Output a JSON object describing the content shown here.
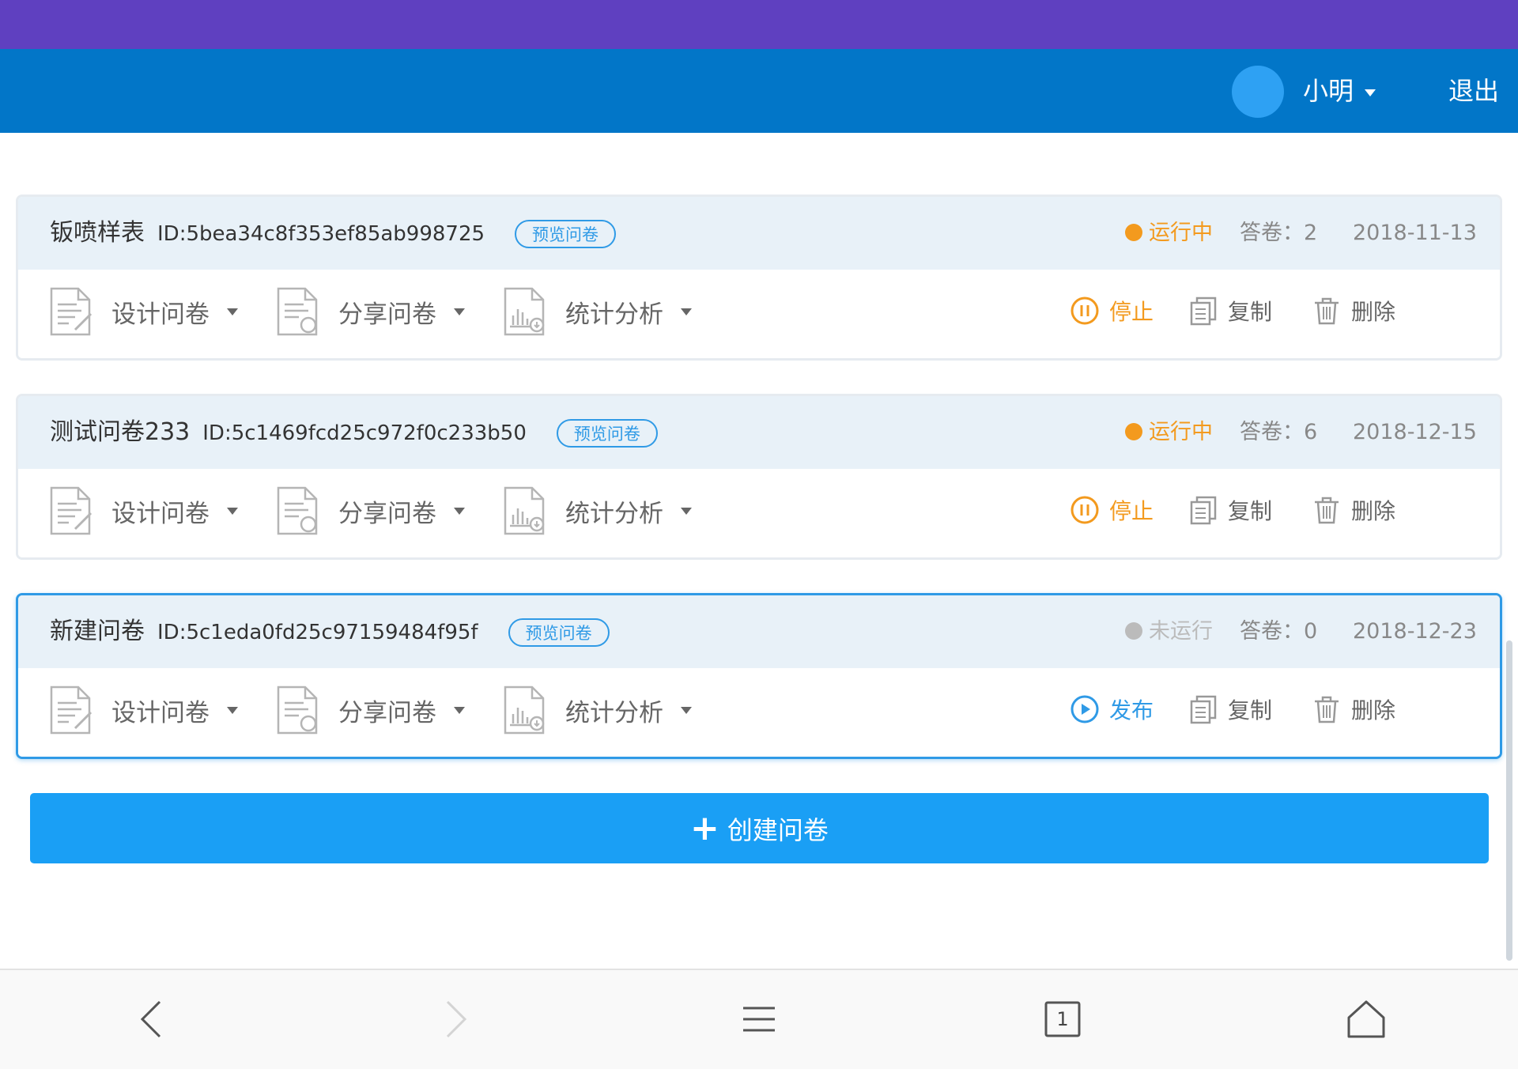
{
  "header": {
    "user_name": "小明",
    "logout_label": "退出"
  },
  "surveys": [
    {
      "name": "钣喷样表",
      "id_text": "ID:5bea34c8f353ef85ab998725",
      "preview_label": "预览问卷",
      "status": "运行中",
      "status_color": "#f39a1e",
      "answers": "答卷：2",
      "date": "2018-11-13",
      "design_label": "设计问卷",
      "share_label": "分享问卷",
      "stats_label": "统计分析",
      "toggle_label": "停止",
      "toggle_icon": "pause-icon",
      "toggle_color": "#f39a1e",
      "copy_label": "复制",
      "delete_label": "删除"
    },
    {
      "name": "测试问卷233",
      "id_text": "ID:5c1469fcd25c972f0c233b50",
      "preview_label": "预览问卷",
      "status": "运行中",
      "status_color": "#f39a1e",
      "answers": "答卷：6",
      "date": "2018-12-15",
      "design_label": "设计问卷",
      "share_label": "分享问卷",
      "stats_label": "统计分析",
      "toggle_label": "停止",
      "toggle_icon": "pause-icon",
      "toggle_color": "#f39a1e",
      "copy_label": "复制",
      "delete_label": "删除"
    },
    {
      "name": "新建问卷",
      "id_text": "ID:5c1eda0fd25c97159484f95f",
      "preview_label": "预览问卷",
      "status": "未运行",
      "status_color": "#bbbbbb",
      "answers": "答卷：0",
      "date": "2018-12-23",
      "design_label": "设计问卷",
      "share_label": "分享问卷",
      "stats_label": "统计分析",
      "toggle_label": "发布",
      "toggle_icon": "play-icon",
      "toggle_color": "#2f9ae6",
      "copy_label": "复制",
      "delete_label": "删除"
    }
  ],
  "create_button": {
    "label": "创建问卷"
  },
  "bottom_nav": {
    "tab_count": "1"
  }
}
